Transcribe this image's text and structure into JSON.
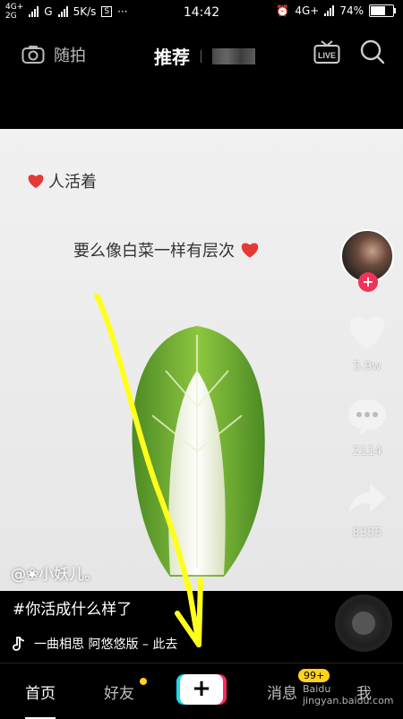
{
  "status": {
    "left_net_top": "4G+",
    "left_net_bottom": "2G",
    "left_g": "G",
    "speed": "5K/s",
    "more": "···",
    "time": "14:42",
    "right_net": "4G+",
    "battery_percent": "74%",
    "battery_level": 0.74
  },
  "topbar": {
    "camera_label": "随拍",
    "center_title": "推荐",
    "icons": [
      "camera-icon",
      "live-tv-icon",
      "search-icon"
    ]
  },
  "video": {
    "caption1": "人活着",
    "caption2": "要么像白菜一样有层次"
  },
  "sidebar": {
    "likes": "5.9w",
    "comments": "2114",
    "shares": "8355"
  },
  "post": {
    "author": "@❀小妖儿。",
    "description": "#你活成什么样了",
    "music": "一曲相思 阿悠悠版 – 此去"
  },
  "nav": {
    "home": "首页",
    "friends": "好友",
    "messages": "消息",
    "messages_badge": "99+",
    "me": "我",
    "add_symbol": "+"
  },
  "watermark": "Baidu jingyan.baidu.com",
  "colors": {
    "accent_red": "#f03358",
    "badge_yellow": "#ffd21e",
    "arrow_yellow": "#ffff1e"
  }
}
